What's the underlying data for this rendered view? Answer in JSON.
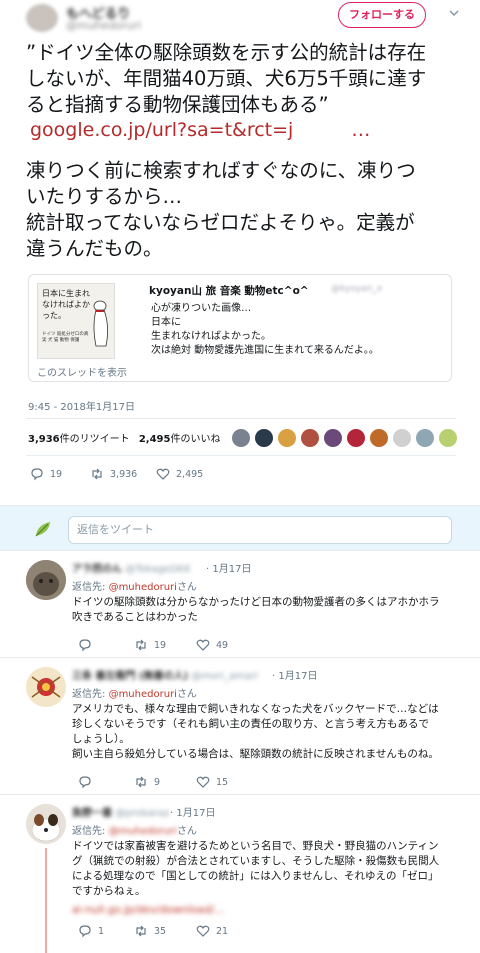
{
  "header": {
    "display_name": "もへどるり",
    "handle": "@muhedoruri",
    "follow_label": "フォローする"
  },
  "tweet": {
    "quote_lines": [
      "”ドイツ全体の駆除頭数を示す公的統計は存在",
      "しないが、年間猫40万頭、犬6万5千頭に達す",
      "ると指摘する動物保護団体もある”"
    ],
    "url": "google.co.jp/url?sa=t&rct=j",
    "url_ellipsis": "…",
    "body_lines": [
      "凍りつく前に検索すればすぐなのに、凍りつ",
      "いたりするから…",
      "統計取ってないならゼロだよそりゃ。定義が",
      "違うんだもの。"
    ]
  },
  "quoted": {
    "thumb_title": "日本に生まれなければよかった。",
    "thumb_caption": "ドイツ 殺処分ゼロの真実 犬 猫 動物 保護",
    "author": "kyoyan山 旅 音楽 動物etc^o^",
    "handle": "@kyoyan_o",
    "lines": [
      "心が凍りついた画像…",
      "日本に",
      "生まれなければよかった。",
      "次は絶対 動物愛護先進国に生まれて来るんだよ。。"
    ],
    "show_thread": "このスレッドを表示"
  },
  "timestamp": "9:45 - 2018年1月17日",
  "stats": {
    "retweets": "3,936",
    "retweets_label": "件のリツイート",
    "likes": "2,495",
    "likes_label": "件のいいね"
  },
  "actions": {
    "replies": "19",
    "retweets": "3,936",
    "likes": "2,495"
  },
  "reply_box": {
    "placeholder": "返信をツイート"
  },
  "replies": [
    {
      "name": "アラ然のん",
      "handle": "@TokageDKK",
      "date": "1月17日",
      "to_prefix": "返信先:",
      "to": "@muhedoruri",
      "to_suffix": "さん",
      "lines": [
        "ドイツの駆除頭数は分からなかったけど日本の動物愛護者の多くはアホかホラ",
        "吹きであることはわかった"
      ],
      "reply_count": "",
      "retweet_count": "19",
      "like_count": "49"
    },
    {
      "name": "三条 善左衛門 (無善の人)",
      "handle": "@mori_amari",
      "date": "1月17日",
      "to_prefix": "返信先:",
      "to": "@muhedoruri",
      "to_suffix": "さん",
      "lines": [
        "アメリカでも、様々な理由で飼いきれなくなった犬をバックヤードで…などは",
        "珍しくないそうです（それも飼い主の責任の取り方、と言う考え方もあるで",
        "しょうし）。",
        "飼い主自ら殺処分している場合は、駆除頭数の統計に反映されませんものね。"
      ],
      "reply_count": "",
      "retweet_count": "9",
      "like_count": "15"
    },
    {
      "name": "負野一番",
      "handle": "@probaraz",
      "date": "1月17日",
      "to_prefix": "返信先:",
      "to": "@muhedoruri",
      "to_suffix": "さん",
      "lines": [
        "ドイツでは家畜被害を避けるためという名目で、野良犬・野良猫のハンティン",
        "グ（猟銃での射殺）が合法とされていますし、そうした駆除・殺傷数も民間人",
        "による処理なので「国としての統計」には入りませんし、それゆえの「ゼロ」",
        "ですからねぇ。"
      ],
      "blurred_link": "ai-null.go.jp/dev/download/...",
      "reply_count": "1",
      "retweet_count": "35",
      "like_count": "21"
    }
  ],
  "colors": {
    "accent": "#1da1f2",
    "follow": "#e0245e",
    "url": "#b52a2a",
    "reply_bg": "#e8f5fd"
  }
}
